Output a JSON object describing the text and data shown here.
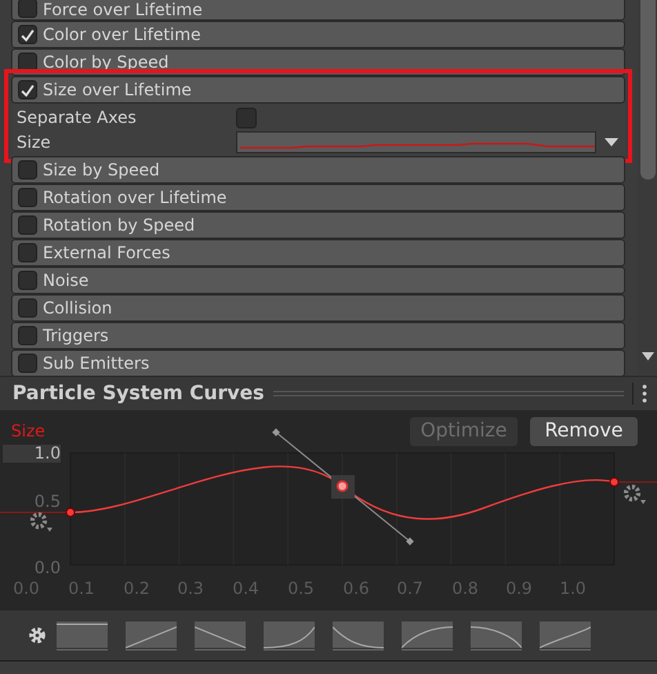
{
  "modules": [
    {
      "label": "Force over Lifetime",
      "checked": false
    },
    {
      "label": "Color over Lifetime",
      "checked": true
    },
    {
      "label": "Color by Speed",
      "checked": false
    },
    {
      "label": "Size over Lifetime",
      "checked": true,
      "expanded": true,
      "highlighted": true,
      "properties": [
        {
          "kind": "checkbox",
          "label": "Separate Axes",
          "checked": false
        },
        {
          "kind": "curve",
          "label": "Size"
        }
      ]
    },
    {
      "label": "Size by Speed",
      "checked": false
    },
    {
      "label": "Rotation over Lifetime",
      "checked": false
    },
    {
      "label": "Rotation by Speed",
      "checked": false
    },
    {
      "label": "External Forces",
      "checked": false
    },
    {
      "label": "Noise",
      "checked": false
    },
    {
      "label": "Collision",
      "checked": false
    },
    {
      "label": "Triggers",
      "checked": false
    },
    {
      "label": "Sub Emitters",
      "checked": false
    }
  ],
  "curves_panel": {
    "title": "Particle System Curves",
    "curve_label": "Size",
    "buttons": [
      {
        "label": "Optimize",
        "disabled": true
      },
      {
        "label": "Remove",
        "disabled": false
      }
    ],
    "y_ticks": [
      "1.0",
      "0.5",
      "0.0"
    ],
    "x_ticks": [
      "0.0",
      "0.1",
      "0.2",
      "0.3",
      "0.4",
      "0.5",
      "0.6",
      "0.7",
      "0.8",
      "0.9",
      "1.0"
    ]
  }
}
